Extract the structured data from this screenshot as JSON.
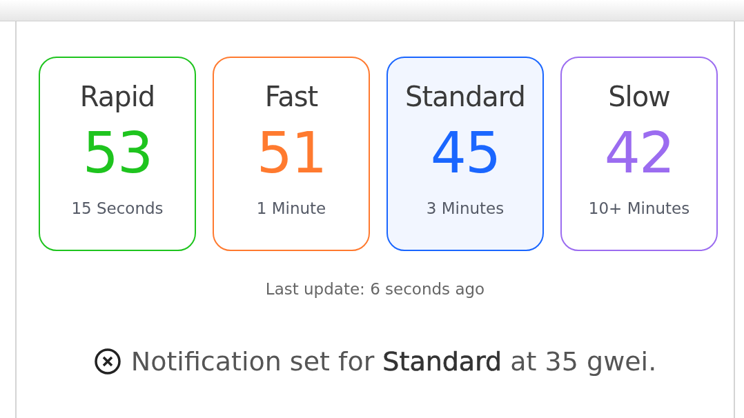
{
  "speeds": [
    {
      "label": "Rapid",
      "value": "53",
      "eta": "15 Seconds",
      "color": "#1ec41e",
      "selected": false
    },
    {
      "label": "Fast",
      "value": "51",
      "eta": "1 Minute",
      "color": "#ff7a2f",
      "selected": false
    },
    {
      "label": "Standard",
      "value": "45",
      "eta": "3 Minutes",
      "color": "#1a66ff",
      "selected": true
    },
    {
      "label": "Slow",
      "value": "42",
      "eta": "10+ Minutes",
      "color": "#9b6cf0",
      "selected": false
    }
  ],
  "last_update": "Last update: 6 seconds ago",
  "notification": {
    "text": "Notification set for **Standard** at 35 gwei."
  }
}
